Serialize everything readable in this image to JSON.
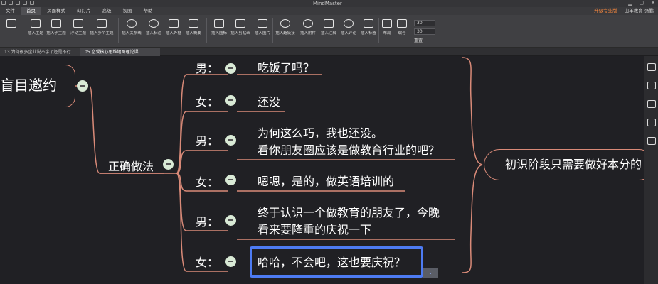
{
  "window": {
    "title": "MindMaster"
  },
  "menu": {
    "items": [
      "文件",
      "首页",
      "页面样式",
      "幻灯片",
      "高级",
      "视图",
      "帮助"
    ],
    "active_index": 1,
    "upgrade_label": "升级专业版",
    "account_label": "山羊教育-张鹏"
  },
  "ribbon": {
    "buttons": [
      "插入主题",
      "插入子主题",
      "浮动主题",
      "插入多个主题",
      "插入关系线",
      "插入标注",
      "插入外框",
      "插入概要",
      "插入图标",
      "插入剪贴画",
      "插入图片",
      "插入超链接",
      "插入附件",
      "插入注释",
      "插入评论",
      "插入标签",
      "布局",
      "编号"
    ],
    "spin1_value": "30",
    "spin2_value": "30",
    "reset_label": "重置"
  },
  "tabs": [
    {
      "label": "13.为何很多企业说不字了还是不行"
    },
    {
      "label": "05.恋爱核心思维地图理论课"
    }
  ],
  "map": {
    "central_topic": "盲目邀约",
    "main_branch": "正确做法",
    "summary": "初识阶段只需要做好本分的",
    "dialogue": [
      {
        "speaker": "男：",
        "line1": "吃饭了吗？",
        "line2": ""
      },
      {
        "speaker": "女：",
        "line1": "还没",
        "line2": ""
      },
      {
        "speaker": "男：",
        "line1": "为何这么巧，我也还没。",
        "line2": "看你朋友圈应该是做教育行业的吧？"
      },
      {
        "speaker": "女：",
        "line1": "嗯嗯，是的，做英语培训的",
        "line2": ""
      },
      {
        "speaker": "男：",
        "line1": "终于认识一个做教育的朋友了，今晚",
        "line2": "看来要隆重的庆祝一下"
      },
      {
        "speaker": "女：",
        "line1": "哈哈，不会吧，这也要庆祝？",
        "line2": ""
      }
    ]
  },
  "colors": {
    "branch_line": "#d98a78",
    "selection": "#4d7bf3",
    "collapse_button": "#d9ead6"
  }
}
